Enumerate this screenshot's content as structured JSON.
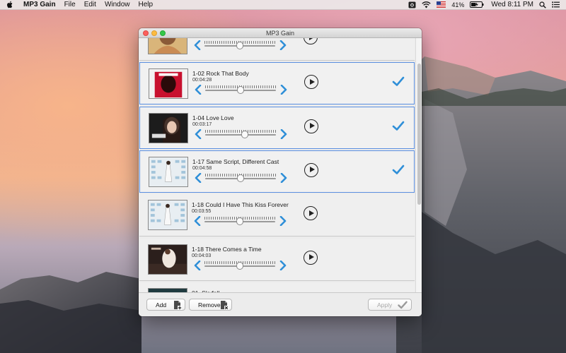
{
  "menubar": {
    "app_name": "MP3 Gain",
    "menus": [
      "File",
      "Edit",
      "Window",
      "Help"
    ],
    "battery_percent": "41%",
    "clock": "Wed 8:11 PM",
    "icons": [
      "apple-icon",
      "camera-icon",
      "wifi-icon",
      "flag-icon",
      "battery-icon",
      "spotlight-icon",
      "notification-center-icon"
    ]
  },
  "window": {
    "title": "MP3 Gain"
  },
  "tracks": [
    {
      "title": "",
      "duration": "",
      "gain_fraction": 0.5,
      "selected": false,
      "cover": "mariah"
    },
    {
      "title": "1-02 Rock That Body",
      "duration": "00:04:28",
      "gain_fraction": 0.5,
      "selected": true,
      "cover": "red"
    },
    {
      "title": "1-04 Love Love",
      "duration": "00:03:17",
      "gain_fraction": 0.56,
      "selected": true,
      "cover": "amy"
    },
    {
      "title": "1-17 Same Script, Different Cast",
      "duration": "00:04:58",
      "gain_fraction": 0.5,
      "selected": true,
      "cover": "bobby"
    },
    {
      "title": "1-18 Could I Have This Kiss Forever",
      "duration": "00:03:55",
      "gain_fraction": 0.5,
      "selected": false,
      "cover": "bobby"
    },
    {
      "title": "1-18 There Comes a Time",
      "duration": "00:04:03",
      "gain_fraction": 0.5,
      "selected": false,
      "cover": "whitney"
    },
    {
      "title": "01. Skyfall",
      "duration": "",
      "gain_fraction": 0.5,
      "selected": false,
      "cover": "dark"
    }
  ],
  "footer": {
    "add_label": "Add",
    "remove_label": "Remove",
    "apply_label": "Apply"
  },
  "colors": {
    "accent": "#2f8fd8",
    "selection_border": "#5a8ee0"
  }
}
